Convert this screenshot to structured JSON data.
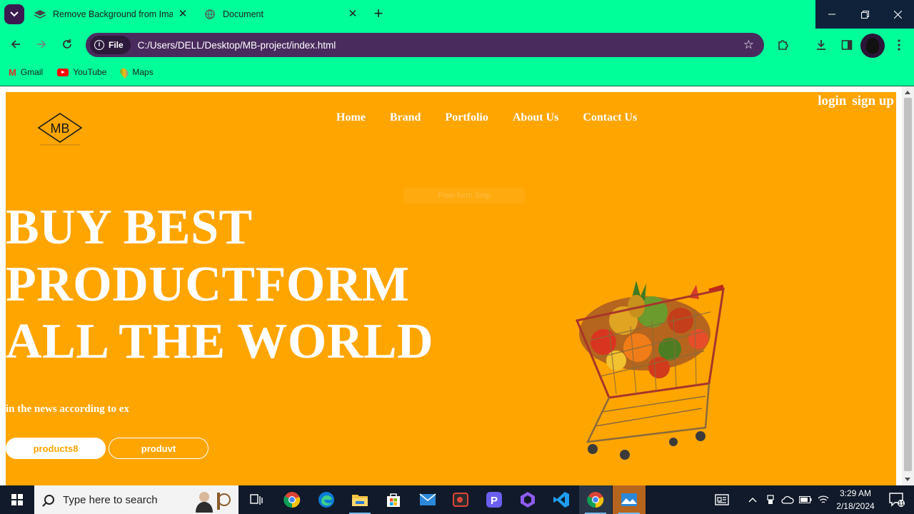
{
  "browser": {
    "tabs": [
      {
        "title": "Remove Background from Imag",
        "icon": "image-icon"
      },
      {
        "title": "Document",
        "icon": "globe-icon"
      }
    ],
    "close_symbol": "✕",
    "new_tab_symbol": "+",
    "address": {
      "scheme_chip": "File",
      "url": "C:/Users/DELL/Desktop/MB-project/index.html"
    },
    "bookmarks": [
      {
        "label": "Gmail",
        "icon": "gmail-icon"
      },
      {
        "label": "YouTube",
        "icon": "youtube-icon"
      },
      {
        "label": "Maps",
        "icon": "maps-icon"
      }
    ],
    "accent_colors": {
      "chrome": "#00ff99",
      "omnibox": "#4a2b5e"
    }
  },
  "page": {
    "logo_text": "MB",
    "nav": [
      "Home",
      "Brand",
      "Portfolio",
      "About Us",
      "Contact Us"
    ],
    "auth": {
      "login": "login",
      "signup": "sign up"
    },
    "snip_overlay": "Free-form Snip",
    "hero": {
      "line1": "BUY BEST",
      "line2": "PRODUCTFORM",
      "line3": "ALL THE WORLD",
      "subtitle": "in the news according to ex"
    },
    "buttons": {
      "primary": "products8",
      "secondary": "produvt"
    },
    "colors": {
      "background": "#ffa500",
      "text": "#ffffff"
    }
  },
  "taskbar": {
    "search_placeholder": "Type here to search",
    "apps": [
      "task-view-icon",
      "chrome-icon",
      "edge-icon",
      "file-explorer-icon",
      "store-icon",
      "mail-icon",
      "recorder-icon",
      "pcloud-icon",
      "copilot-icon",
      "vscode-icon",
      "chrome-icon",
      "photos-icon"
    ],
    "time": "3:29 AM",
    "date": "2/18/2024",
    "notification_count": "11"
  }
}
